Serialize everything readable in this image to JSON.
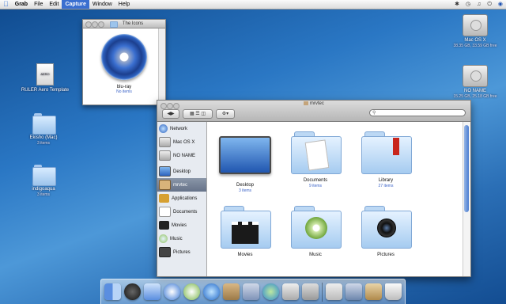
{
  "menubar": {
    "items": [
      "Grab",
      "File",
      "Edit",
      "Capture",
      "Window",
      "Help"
    ],
    "selected": "Capture"
  },
  "desktop": {
    "icons": [
      {
        "label": "RULER Aero Template",
        "badge": "AERO",
        "sub": ""
      },
      {
        "label": "Ekisho (Mac)",
        "sub": "3 items"
      },
      {
        "label": "indigoaqua",
        "sub": "3 items"
      },
      {
        "label": "Mac OS X",
        "sub": "38.35 GB, 33.59 GB free"
      },
      {
        "label": "NO NAME",
        "sub": "15.25 GB, 25.18 GB free"
      }
    ]
  },
  "icon_window": {
    "title": "The Icons",
    "item_name": "blu-ray",
    "item_count": "No items"
  },
  "finder": {
    "title": "mrvtec",
    "search_placeholder": "",
    "sidebar": [
      {
        "label": "Network",
        "icon": "network-icon"
      },
      {
        "label": "Mac OS X",
        "icon": "hard-drive-icon"
      },
      {
        "label": "NO NAME",
        "icon": "hard-drive-icon"
      },
      {
        "label": "Desktop",
        "icon": "desktop-icon"
      },
      {
        "label": "mrvtec",
        "icon": "home-icon"
      },
      {
        "label": "Applications",
        "icon": "applications-icon"
      },
      {
        "label": "Documents",
        "icon": "documents-icon"
      },
      {
        "label": "Movies",
        "icon": "movies-icon"
      },
      {
        "label": "Music",
        "icon": "music-icon"
      },
      {
        "label": "Pictures",
        "icon": "pictures-icon"
      }
    ],
    "selected_sidebar": "mrvtec",
    "items": [
      {
        "name": "Desktop",
        "count": "3 items"
      },
      {
        "name": "Documents",
        "count": "9 items"
      },
      {
        "name": "Library",
        "count": "27 items"
      },
      {
        "name": "Movies",
        "count": ""
      },
      {
        "name": "Music",
        "count": ""
      },
      {
        "name": "Pictures",
        "count": ""
      }
    ]
  },
  "dock": {
    "icons": [
      "finder-icon",
      "dashboard-icon",
      "mail-icon",
      "safari-icon",
      "itunes-icon",
      "ical-icon",
      "addressbook-icon",
      "preview-icon",
      "ichat-icon",
      "quicktime-icon",
      "system-preferences-icon",
      "grab-icon",
      "sysinfo-icon",
      "documents-stack-icon",
      "trash-icon"
    ]
  },
  "colors": {
    "accent": "#3a6fd0",
    "desktop": "#2a77c4"
  }
}
